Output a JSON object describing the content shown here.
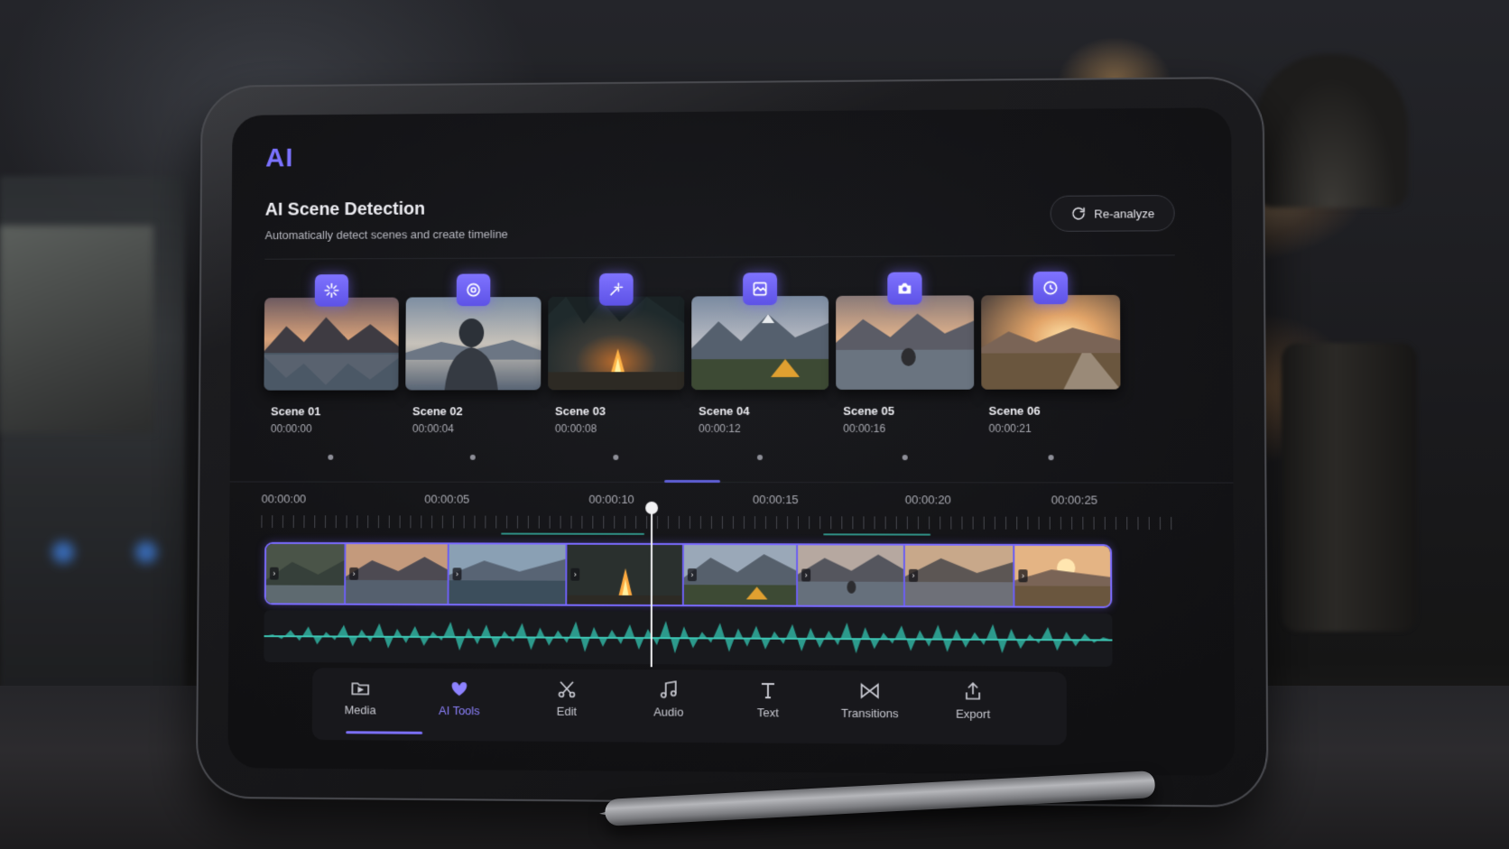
{
  "app": {
    "logo": "AI"
  },
  "header": {
    "title": "AI Scene Detection",
    "subtitle": "Automatically detect scenes and create timeline",
    "reanalyze_label": "Re-analyze"
  },
  "scenes": [
    {
      "name": "Scene 01",
      "time": "00:00:00",
      "icon": "sparkle-icon",
      "thumb": "mountain-lake"
    },
    {
      "name": "Scene 02",
      "time": "00:00:04",
      "icon": "target-icon",
      "thumb": "hiker-back"
    },
    {
      "name": "Scene 03",
      "time": "00:00:08",
      "icon": "magic-icon",
      "thumb": "campfire"
    },
    {
      "name": "Scene 04",
      "time": "00:00:12",
      "icon": "frame-icon",
      "thumb": "tent"
    },
    {
      "name": "Scene 05",
      "time": "00:00:16",
      "icon": "camera-icon",
      "thumb": "lake-sitter"
    },
    {
      "name": "Scene 06",
      "time": "00:00:21",
      "icon": "clock-icon",
      "thumb": "sunset-road"
    }
  ],
  "timeline": {
    "ruler_labels": [
      "00:00:00",
      "00:00:05",
      "00:00:10",
      "00:00:15",
      "00:00:20",
      "00:00:25"
    ],
    "clip_count": 8,
    "accent_color": "#7a6bff",
    "waveform_color": "#2fa899"
  },
  "toolbar": {
    "items": [
      {
        "label": "Media",
        "icon": "media-folder-icon",
        "active": false
      },
      {
        "label": "AI Tools",
        "icon": "ai-tools-icon",
        "active": true
      },
      {
        "label": "Edit",
        "icon": "scissors-icon",
        "active": false
      },
      {
        "label": "Audio",
        "icon": "music-note-icon",
        "active": false
      },
      {
        "label": "Text",
        "icon": "text-icon",
        "active": false
      },
      {
        "label": "Transitions",
        "icon": "transitions-icon",
        "active": false
      },
      {
        "label": "Export",
        "icon": "export-icon",
        "active": false
      }
    ]
  }
}
